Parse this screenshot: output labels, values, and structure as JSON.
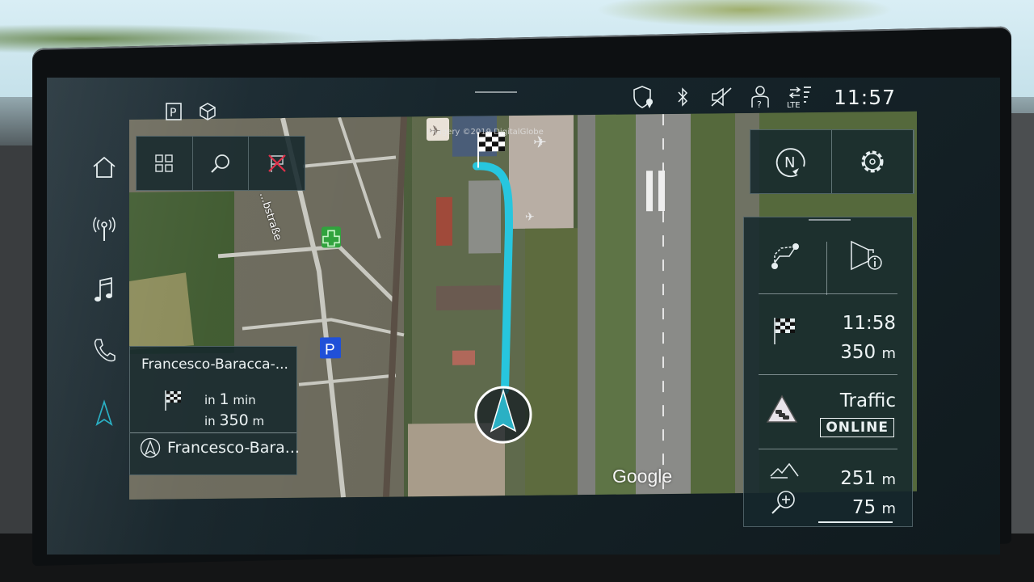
{
  "status_bar": {
    "left_icons": [
      "parking-icon",
      "3d-cube-icon"
    ],
    "right_icons": [
      "shield-location-icon",
      "bluetooth-icon",
      "mute-icon",
      "user-help-icon",
      "lte-signal-icon"
    ],
    "network_label": "LTE",
    "time": "11:57"
  },
  "sidebar": {
    "items": [
      {
        "name": "home",
        "icon": "home-icon"
      },
      {
        "name": "radio",
        "icon": "radio-antenna-icon"
      },
      {
        "name": "media",
        "icon": "music-note-icon"
      },
      {
        "name": "phone",
        "icon": "phone-icon"
      },
      {
        "name": "navigation",
        "icon": "navigation-arrow-icon",
        "active": true
      }
    ]
  },
  "map_tools": {
    "buttons": [
      {
        "name": "menu",
        "icon": "grid-icon"
      },
      {
        "name": "search",
        "icon": "search-icon"
      },
      {
        "name": "cancel-guidance",
        "icon": "cancel-route-flag-icon"
      }
    ]
  },
  "map_controls": {
    "buttons": [
      {
        "name": "north-up",
        "icon": "compass-north-icon",
        "label": "N"
      },
      {
        "name": "settings",
        "icon": "gear-icon"
      }
    ]
  },
  "map": {
    "copyright": "Imagery ©2019 DigitalGlobe",
    "attribution": "Google",
    "street_label": "...bstraße",
    "poi": [
      {
        "type": "pharmacy",
        "icon": "pharmacy-cross-icon"
      },
      {
        "type": "parking",
        "icon": "parking-sign-icon",
        "label": "P"
      },
      {
        "type": "airport",
        "icon": "airplane-icon"
      },
      {
        "type": "destination",
        "icon": "checkered-flag-icon"
      }
    ],
    "route_color": "#27c6de",
    "vehicle_color": "#2ab0c4"
  },
  "guidance": {
    "destination": "Francesco-Baracca-...",
    "time_prefix": "in",
    "time_value": "1",
    "time_unit": "min",
    "distance_prefix": "in",
    "distance_value": "350",
    "distance_unit": "m",
    "current_street": "Francesco-Bara..."
  },
  "info_panel": {
    "route_button_icon": "route-options-icon",
    "announcement_button_icon": "speaker-info-icon",
    "arrival_time": "11:58",
    "remaining_distance": "350",
    "remaining_distance_unit": "m",
    "traffic_label": "Traffic",
    "traffic_status": "ONLINE",
    "altitude": "251",
    "altitude_unit": "m",
    "scale": "75",
    "scale_unit": "m"
  }
}
